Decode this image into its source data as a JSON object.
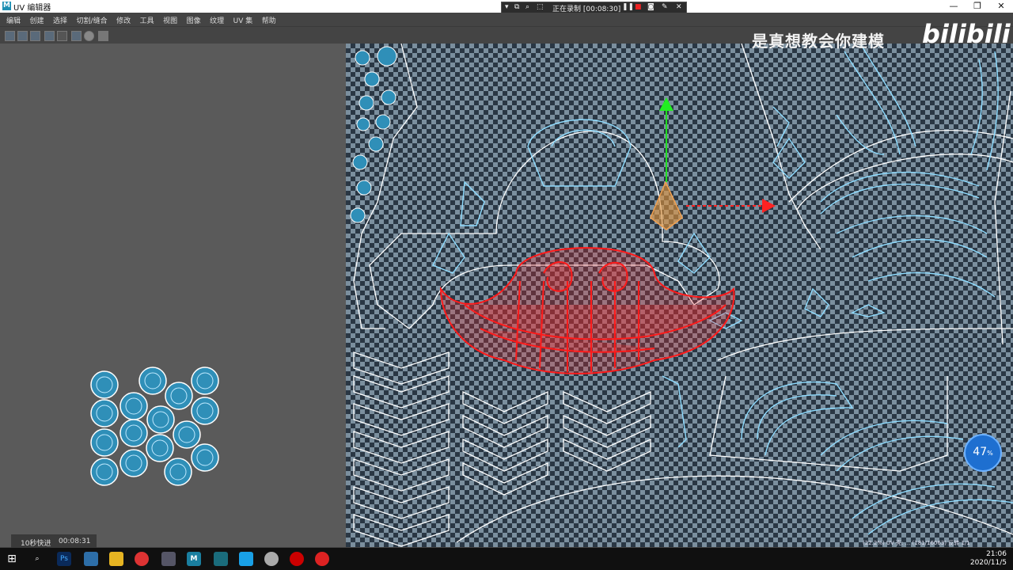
{
  "window": {
    "title": "UV 编辑器",
    "logo": "M",
    "minimize": "—",
    "maximize": "❐",
    "close": "✕"
  },
  "recorder": {
    "status": "正在录制 [00:08:30]"
  },
  "menu": [
    "编辑",
    "创建",
    "选择",
    "切割/缝合",
    "修改",
    "工具",
    "视图",
    "图像",
    "纹理",
    "UV 集",
    "帮助"
  ],
  "watermark": {
    "text": "是真想教会你建模",
    "brand": "bilibili"
  },
  "timer": {
    "label": "10秒快进",
    "time": "00:08:31"
  },
  "viewport": {
    "status": "(22.2%) UV 壳: ... (181/16063) 反转 1/1"
  },
  "badge": {
    "value": "47",
    "unit": "%"
  },
  "taskbar": {
    "time": "21:06",
    "date": "2020/11/5"
  },
  "colors": {
    "accent_red": "#ff1a1a",
    "uv_cyan": "#7fd4ff",
    "bg_panel": "#5a5a5a"
  }
}
